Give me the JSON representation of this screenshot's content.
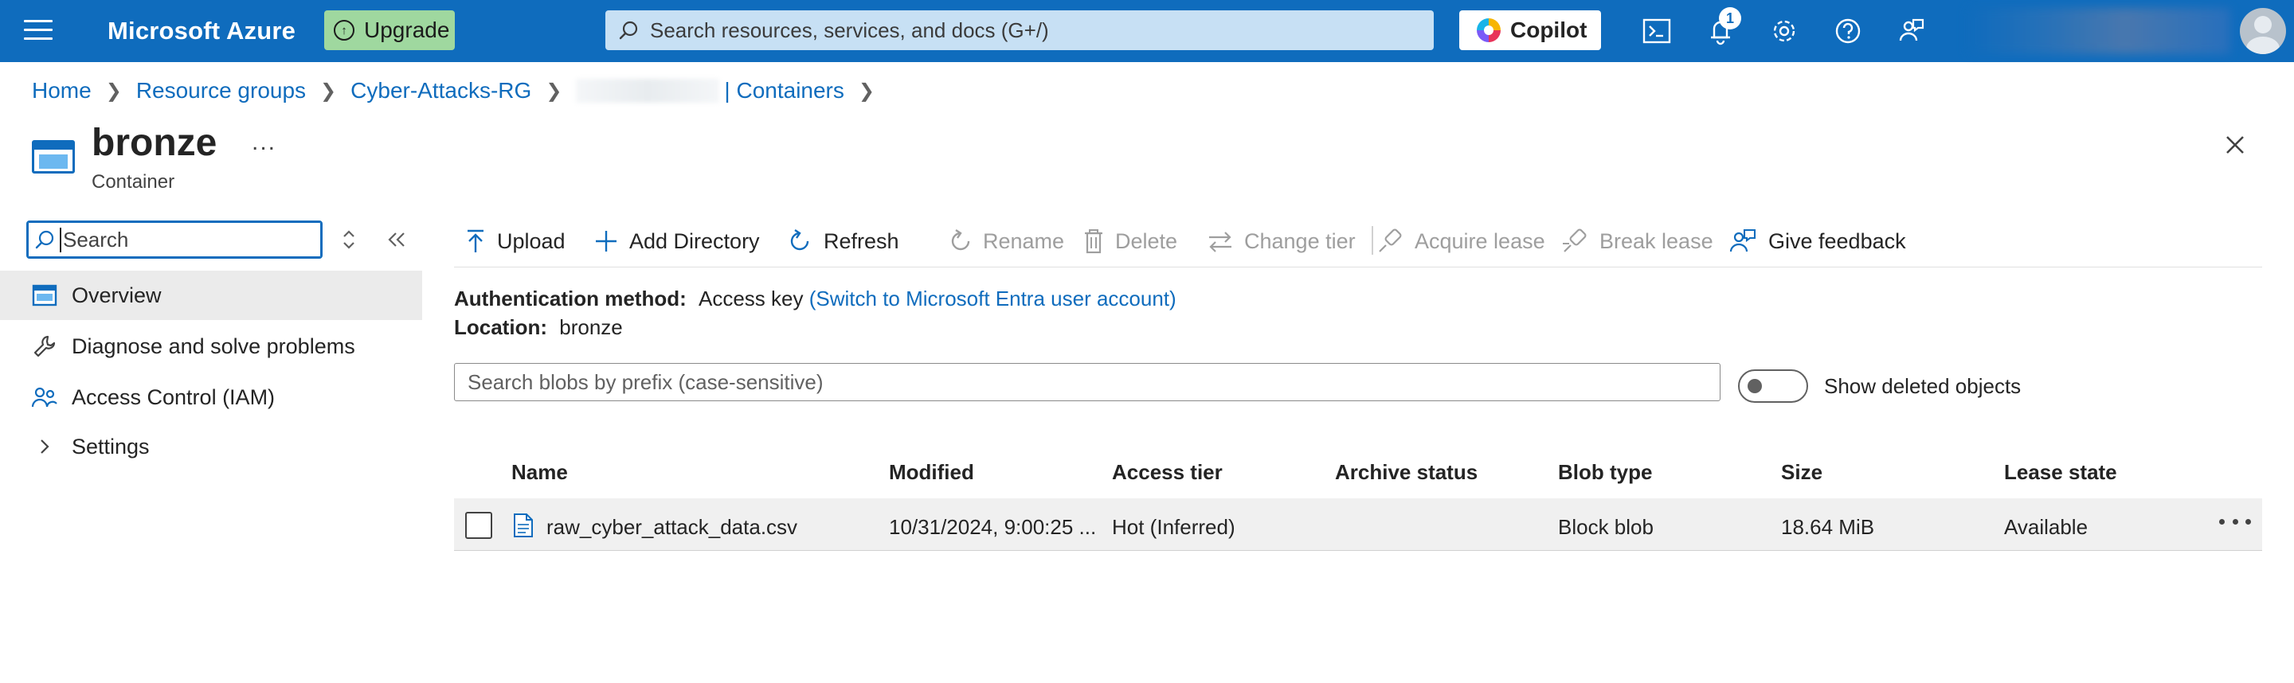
{
  "topbar": {
    "brand": "Microsoft Azure",
    "upgrade_label": "Upgrade",
    "search_placeholder": "Search resources, services, and docs (G+/)",
    "copilot_label": "Copilot",
    "notification_count": "1",
    "icons": [
      "menu-icon",
      "cloud-shell-icon",
      "bell-icon",
      "gear-icon",
      "help-icon",
      "feedback-icon"
    ],
    "accent": "#0f6cbd",
    "upgrade_color": "#9fd89f"
  },
  "breadcrumb": {
    "items": [
      "Home",
      "Resource groups",
      "Cyber-Attacks-RG",
      "| Containers"
    ]
  },
  "header": {
    "title": "bronze",
    "subtitle": "Container",
    "more": "..."
  },
  "nav": {
    "search_placeholder": "Search",
    "items": [
      {
        "label": "Overview",
        "icon": "container-icon"
      },
      {
        "label": "Diagnose and solve problems",
        "icon": "wrench-icon"
      },
      {
        "label": "Access Control (IAM)",
        "icon": "people-icon"
      },
      {
        "label": "Settings",
        "icon": "chevron-right-icon"
      }
    ]
  },
  "toolbar": {
    "upload": "Upload",
    "add_directory": "Add Directory",
    "refresh": "Refresh",
    "rename": "Rename",
    "delete": "Delete",
    "change_tier": "Change tier",
    "acquire_lease": "Acquire lease",
    "break_lease": "Break lease",
    "give_feedback": "Give feedback"
  },
  "info": {
    "auth_label": "Authentication method:",
    "auth_value": "Access key",
    "auth_link": "(Switch to Microsoft Entra user account)",
    "location_label": "Location:",
    "location_value": "bronze"
  },
  "blob_search": {
    "placeholder": "Search blobs by prefix (case-sensitive)",
    "toggle_label": "Show deleted objects"
  },
  "table": {
    "columns": [
      "Name",
      "Modified",
      "Access tier",
      "Archive status",
      "Blob type",
      "Size",
      "Lease state"
    ],
    "rows": [
      {
        "name": "raw_cyber_attack_data.csv",
        "modified": "10/31/2024, 9:00:25 ...",
        "access_tier": "Hot (Inferred)",
        "archive_status": "",
        "blob_type": "Block blob",
        "size": "18.64 MiB",
        "lease_state": "Available"
      }
    ]
  }
}
